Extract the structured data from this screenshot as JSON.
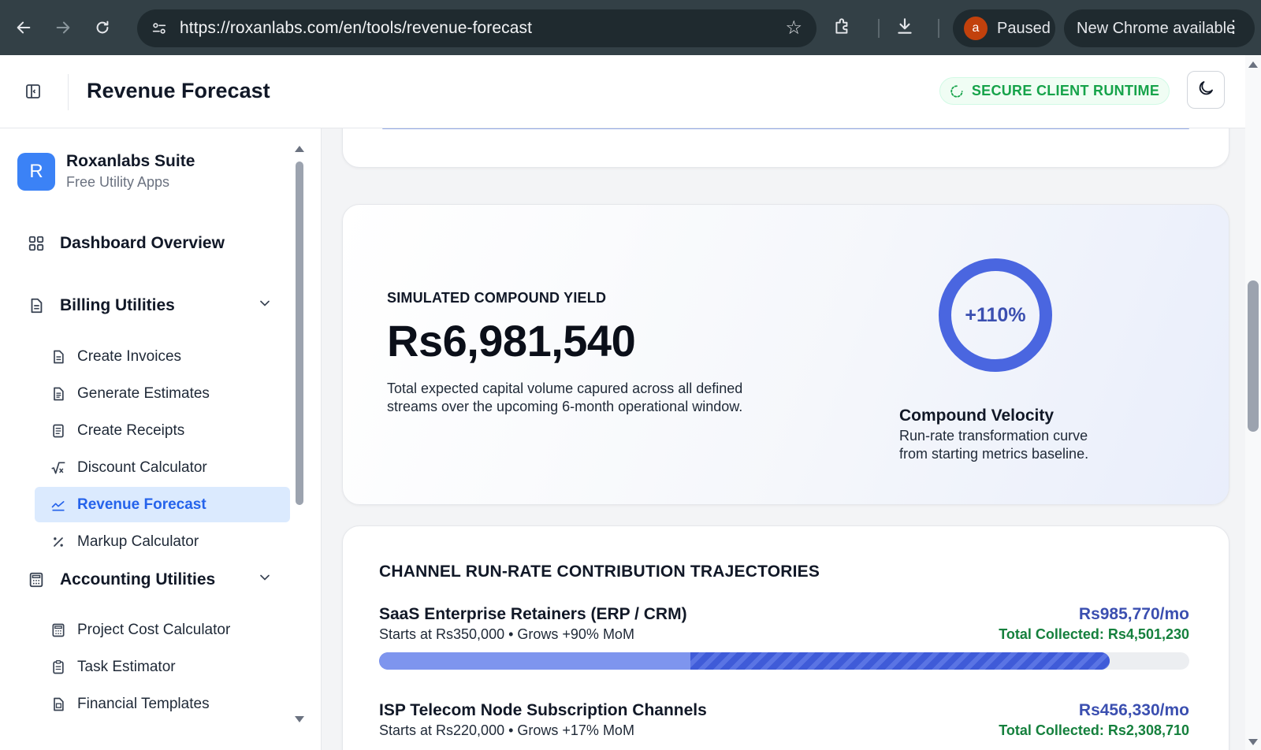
{
  "browser": {
    "url": "https://roxanlabs.com/en/tools/revenue-forecast",
    "profile_initial": "a",
    "profile_status": "Paused",
    "update_label": "New Chrome available"
  },
  "header": {
    "title": "Revenue Forecast",
    "badge": "SECURE CLIENT RUNTIME"
  },
  "sidebar": {
    "brand_initial": "R",
    "brand_name": "Roxanlabs Suite",
    "brand_sub": "Free Utility Apps",
    "dashboard": "Dashboard Overview",
    "billing": {
      "label": "Billing Utilities",
      "items": [
        "Create Invoices",
        "Generate Estimates",
        "Create Receipts",
        "Discount Calculator",
        "Revenue Forecast",
        "Markup Calculator"
      ]
    },
    "accounting": {
      "label": "Accounting Utilities",
      "items": [
        "Project Cost Calculator",
        "Task Estimator",
        "Financial Templates"
      ]
    }
  },
  "yield": {
    "label": "SIMULATED COMPOUND YIELD",
    "value": "Rs6,981,540",
    "description": "Total expected capital volume capured across all defined streams over the upcoming 6-month operational window.",
    "donut_label": "+110%",
    "velocity_title": "Compound Velocity",
    "velocity_desc": "Run-rate transformation curve from starting metrics baseline."
  },
  "channels": {
    "title": "CHANNEL RUN-RATE CONTRIBUTION TRAJECTORIES",
    "streams": [
      {
        "name": "SaaS Enterprise Retainers (ERP / CRM)",
        "meta": "Starts at Rs350,000 • Grows +90% MoM",
        "rate": "Rs985,770/mo",
        "total": "Total Collected: Rs4,501,230",
        "base_fraction": 0.384,
        "fill_fraction": 0.902
      },
      {
        "name": "ISP Telecom Node Subscription Channels",
        "meta": "Starts at Rs220,000 • Grows +17% MoM",
        "rate": "Rs456,330/mo",
        "total": "Total Collected: Rs2,308,710"
      }
    ]
  },
  "colors": {
    "accent": "#3b4fb0",
    "active_bg": "#dbeafe",
    "success": "#15803d"
  }
}
